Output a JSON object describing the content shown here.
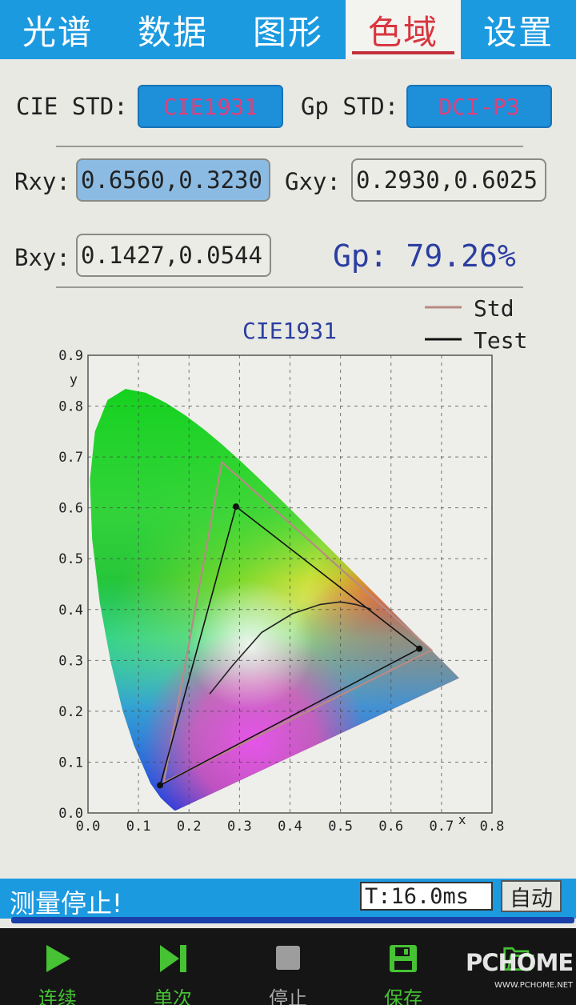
{
  "tabs": [
    {
      "label": "光谱",
      "active": false
    },
    {
      "label": "数据",
      "active": false
    },
    {
      "label": "图形",
      "active": false
    },
    {
      "label": "色域",
      "active": true
    },
    {
      "label": "设置",
      "active": false
    }
  ],
  "standards": {
    "cie_label": "CIE STD:",
    "cie_value": "CIE1931",
    "gp_label": "Gp STD:",
    "gp_value": "DCI-P3"
  },
  "coords": {
    "r_label": "Rxy:",
    "r_value": "0.6560,0.3230",
    "g_label": "Gxy:",
    "g_value": "0.2930,0.6025",
    "b_label": "Bxy:",
    "b_value": "0.1427,0.0544"
  },
  "gp_result": "Gp: 79.26%",
  "chart_data": {
    "type": "scatter",
    "title": "CIE1931",
    "xlabel": "x",
    "ylabel": "y",
    "xlim": [
      0.0,
      0.8
    ],
    "ylim": [
      0.0,
      0.9
    ],
    "xticks": [
      "0.0",
      "0.1",
      "0.2",
      "0.3",
      "0.4",
      "0.5",
      "0.6",
      "0.7",
      "0.8"
    ],
    "yticks": [
      "0.0",
      "0.1",
      "0.2",
      "0.3",
      "0.4",
      "0.5",
      "0.6",
      "0.7",
      "0.8",
      "0.9"
    ],
    "grid": true,
    "legend_position": "top-right",
    "series": [
      {
        "name": "Std",
        "color": "#b88a84",
        "points": [
          [
            0.68,
            0.32
          ],
          [
            0.265,
            0.69
          ],
          [
            0.15,
            0.06
          ]
        ]
      },
      {
        "name": "Test",
        "color": "#111111",
        "points": [
          [
            0.656,
            0.323
          ],
          [
            0.293,
            0.6025
          ],
          [
            0.1427,
            0.0544
          ]
        ]
      }
    ],
    "planckian_locus": [
      [
        0.241,
        0.234
      ],
      [
        0.287,
        0.291
      ],
      [
        0.344,
        0.355
      ],
      [
        0.405,
        0.392
      ],
      [
        0.46,
        0.41
      ],
      [
        0.5,
        0.415
      ],
      [
        0.53,
        0.41
      ],
      [
        0.56,
        0.401
      ]
    ],
    "spectral_locus": [
      [
        0.1741,
        0.005
      ],
      [
        0.1738,
        0.0049
      ],
      [
        0.1733,
        0.0048
      ],
      [
        0.1726,
        0.0048
      ],
      [
        0.1714,
        0.0051
      ],
      [
        0.1689,
        0.0069
      ],
      [
        0.1644,
        0.0109
      ],
      [
        0.1566,
        0.0177
      ],
      [
        0.144,
        0.0297
      ],
      [
        0.1241,
        0.0578
      ],
      [
        0.0913,
        0.1327
      ],
      [
        0.0687,
        0.2007
      ],
      [
        0.0454,
        0.295
      ],
      [
        0.0235,
        0.4127
      ],
      [
        0.0082,
        0.5384
      ],
      [
        0.0039,
        0.6548
      ],
      [
        0.0139,
        0.7502
      ],
      [
        0.0389,
        0.812
      ],
      [
        0.0743,
        0.8338
      ],
      [
        0.1142,
        0.8262
      ],
      [
        0.1547,
        0.8059
      ],
      [
        0.1929,
        0.7816
      ],
      [
        0.2296,
        0.7543
      ],
      [
        0.2658,
        0.7243
      ],
      [
        0.3016,
        0.6923
      ],
      [
        0.3373,
        0.6589
      ],
      [
        0.3731,
        0.6245
      ],
      [
        0.4087,
        0.5896
      ],
      [
        0.4441,
        0.5547
      ],
      [
        0.4788,
        0.5202
      ],
      [
        0.5125,
        0.4866
      ],
      [
        0.5448,
        0.4544
      ],
      [
        0.5752,
        0.4242
      ],
      [
        0.6029,
        0.3965
      ],
      [
        0.627,
        0.3725
      ],
      [
        0.6482,
        0.3514
      ],
      [
        0.6658,
        0.334
      ],
      [
        0.6801,
        0.3197
      ],
      [
        0.6915,
        0.3083
      ],
      [
        0.7006,
        0.2993
      ],
      [
        0.7079,
        0.292
      ],
      [
        0.7347,
        0.2653
      ]
    ]
  },
  "status": {
    "message": "测量停止!",
    "time": "T:16.0ms",
    "mode": "自动"
  },
  "toolbar": [
    {
      "label": "连续",
      "icon": "play-icon",
      "enabled": true
    },
    {
      "label": "单次",
      "icon": "step-icon",
      "enabled": true
    },
    {
      "label": "停止",
      "icon": "stop-icon",
      "enabled": false
    },
    {
      "label": "保存",
      "icon": "save-icon",
      "enabled": true
    },
    {
      "label": "",
      "icon": "folder-icon",
      "enabled": true
    }
  ],
  "watermark": {
    "brand": "PCHOME",
    "url": "WWW.PCHOME.NET"
  }
}
